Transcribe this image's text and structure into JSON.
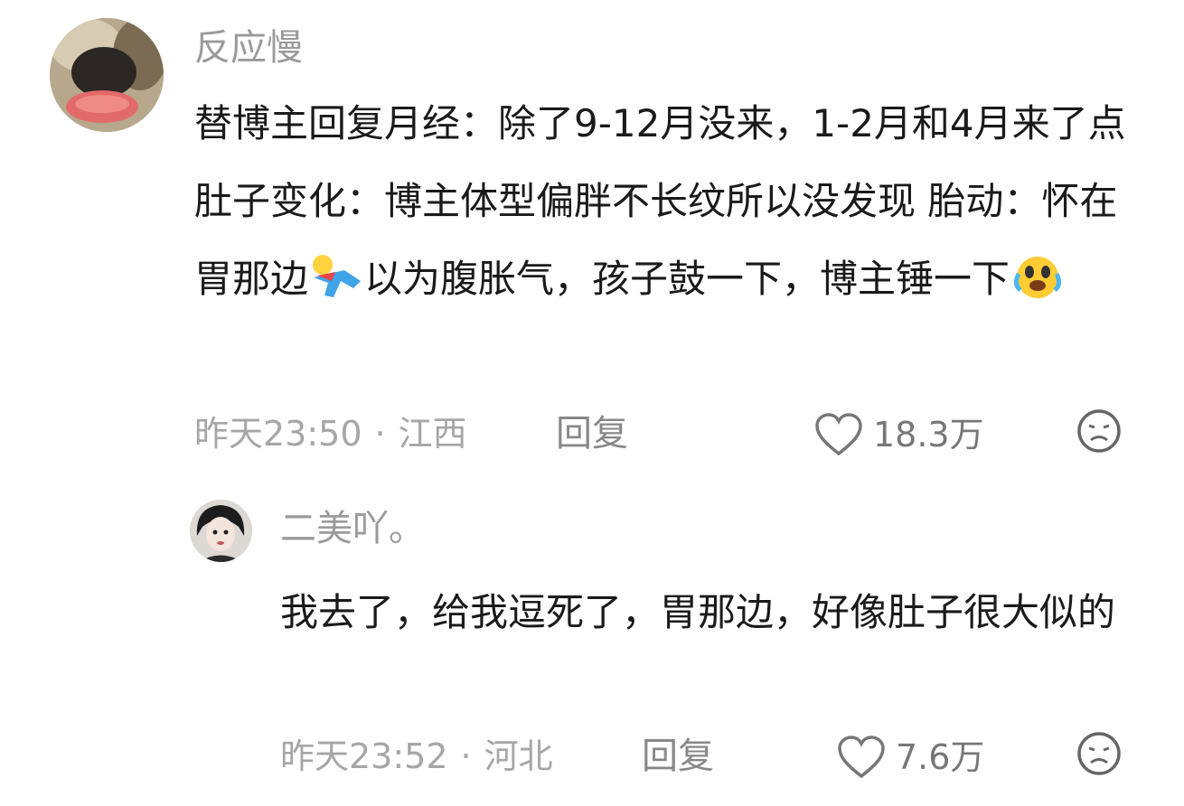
{
  "comments": [
    {
      "username": "反应慢",
      "text_parts": [
        "替博主回复月经：除了9-12月没来，1-2月和4月来了点 肚子变化：博主体型偏胖不长纹所以没发现 胎动：怀在胃那边",
        "以为腹胀气，孩子鼓一下，博主锤一下"
      ],
      "emojis": [
        "crawling-emoji",
        "crying-laughing-emoji"
      ],
      "time": "昨天23:50",
      "location": "江西",
      "reply_label": "回复",
      "likes": "18.3万"
    },
    {
      "username": "二美吖。",
      "text": "我去了，给我逗死了，胃那边，好像肚子很大似的",
      "time": "昨天23:52",
      "location": "河北",
      "reply_label": "回复",
      "likes": "7.6万"
    }
  ],
  "separator": "·",
  "icons": {
    "like": "heart-outline-icon",
    "dislike": "sad-face-icon"
  },
  "colors": {
    "username": "#9a9a9a",
    "body": "#1a1a1a",
    "meta": "#a6a6a6"
  }
}
